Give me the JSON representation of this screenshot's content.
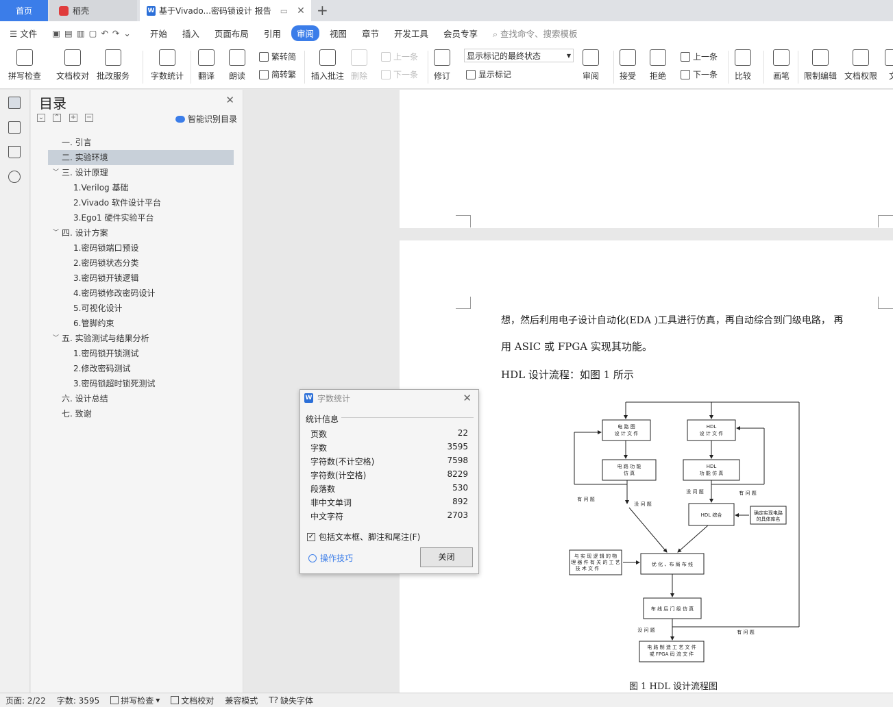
{
  "tabs": {
    "home": "首页",
    "daoke": "稻壳",
    "doc": "基于Vivado...密码锁设计 报告"
  },
  "menu": {
    "file": "文件",
    "items": [
      "开始",
      "插入",
      "页面布局",
      "引用",
      "审阅",
      "视图",
      "章节",
      "开发工具",
      "会员专享"
    ],
    "active": "审阅",
    "search": "查找命令、搜索模板"
  },
  "ribbon": {
    "spell": "拼写检查",
    "proof": "文档校对",
    "revise_service": "批改服务",
    "wordcount": "字数统计",
    "translate": "翻译",
    "read": "朗读",
    "t2s": "繁转简",
    "s2t": "简转繁",
    "insert_comment": "插入批注",
    "delete": "删除",
    "prev_comment": "上一条",
    "next_comment": "下一条",
    "track": "修订",
    "markup_state": "显示标记的最终状态",
    "show_markup": "显示标记",
    "review": "审阅",
    "accept": "接受",
    "reject": "拒绝",
    "prev": "上一条",
    "next": "下一条",
    "compare": "比较",
    "pen": "画笔",
    "restrict": "限制编辑",
    "permission": "文档权限",
    "cut": "文"
  },
  "toc": {
    "title": "目录",
    "smart": "智能识别目录",
    "items": [
      {
        "text": "一.   引言",
        "indent": 1
      },
      {
        "text": "二.   实验环境",
        "indent": 1,
        "selected": true
      },
      {
        "text": "三.   设计原理",
        "indent": 1,
        "expand": true
      },
      {
        "text": "1.Verilog 基础",
        "indent": 2
      },
      {
        "text": "2.Vivado 软件设计平台",
        "indent": 2
      },
      {
        "text": "3.Ego1 硬件实验平台",
        "indent": 2
      },
      {
        "text": "四.   设计方案",
        "indent": 1,
        "expand": true
      },
      {
        "text": "1.密码锁端口预设",
        "indent": 2
      },
      {
        "text": "2.密码锁状态分类",
        "indent": 2
      },
      {
        "text": "3.密码锁开锁逻辑",
        "indent": 2
      },
      {
        "text": "4.密码锁修改密码设计",
        "indent": 2
      },
      {
        "text": "5.可视化设计",
        "indent": 2
      },
      {
        "text": "6.管脚约束",
        "indent": 2
      },
      {
        "text": "五.   实验测试与结果分析",
        "indent": 1,
        "expand": true
      },
      {
        "text": "1.密码锁开锁测试",
        "indent": 2
      },
      {
        "text": "2.修改密码测试",
        "indent": 2
      },
      {
        "text": "3.密码锁超时锁死测试",
        "indent": 2
      },
      {
        "text": "六.   设计总结",
        "indent": 1
      },
      {
        "text": "七.   致谢",
        "indent": 1
      }
    ]
  },
  "document": {
    "line1": "想，然后利用电子设计自动化(EDA )工具进行仿真，再自动综合到门级电路，  再",
    "line2": "用 ASIC 或 FPGA 实现其功能。",
    "line3": "HDL 设计流程：如图 1 所示",
    "caption": "图 1 HDL 设计流程图"
  },
  "flowchart": {
    "b1": [
      "电 路 图",
      "设 计 文 件"
    ],
    "b2": [
      "HDL",
      "设 计 文 件"
    ],
    "b3": [
      "电 路 功 能",
      "仿 真"
    ],
    "b4": [
      "HDL",
      "功 能 仿 真"
    ],
    "b5": "HDL 综合",
    "b6": [
      "确定实现电路",
      "的具体库名"
    ],
    "b7": [
      "与 实 现 逻 辑 的 物",
      "理 器 件 有 关 的 工 艺",
      "技 术 文 件"
    ],
    "b8": "优 化 、布 局 布 线",
    "b9": "布 线 后 门 级 仿 真",
    "b10": [
      "电 路 制 造 工 艺 文 件",
      "或 FPGA  码 流  文 件"
    ],
    "has_problem": "有 问 题",
    "no_problem": "没 问 题"
  },
  "dialog": {
    "title": "字数统计",
    "section": "统计信息",
    "stats": [
      {
        "label": "页数",
        "value": "22"
      },
      {
        "label": "字数",
        "value": "3595"
      },
      {
        "label": "字符数(不计空格)",
        "value": "7598"
      },
      {
        "label": "字符数(计空格)",
        "value": "8229"
      },
      {
        "label": "段落数",
        "value": "530"
      },
      {
        "label": "非中文单词",
        "value": "892"
      },
      {
        "label": "中文字符",
        "value": "2703"
      }
    ],
    "include": "包括文本框、脚注和尾注(F)",
    "tips": "操作技巧",
    "close": "关闭"
  },
  "status": {
    "page": "页面: 2/22",
    "words": "字数: 3595",
    "spell": "拼写检查",
    "proof": "文档校对",
    "compat": "兼容模式",
    "font": "缺失字体"
  }
}
